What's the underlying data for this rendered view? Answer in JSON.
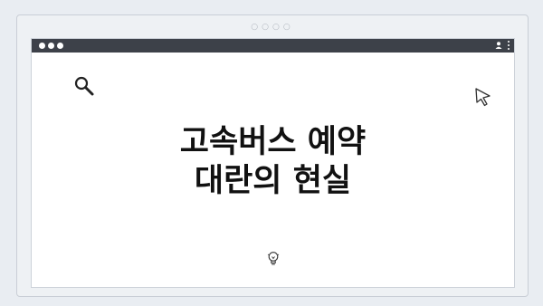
{
  "window": {
    "controls": [
      "close-dot",
      "minimize-dot",
      "maximize-dot"
    ],
    "icons": [
      "user-icon",
      "kebab-menu-icon"
    ]
  },
  "canvas": {
    "title_line1": "고속버스 예약",
    "title_line2": "대란의 현실",
    "icons": [
      "search-icon",
      "cursor-icon",
      "lightbulb-icon"
    ]
  },
  "colors": {
    "titlebar": "#3d4149",
    "background": "#eef1f4",
    "text": "#111111"
  }
}
